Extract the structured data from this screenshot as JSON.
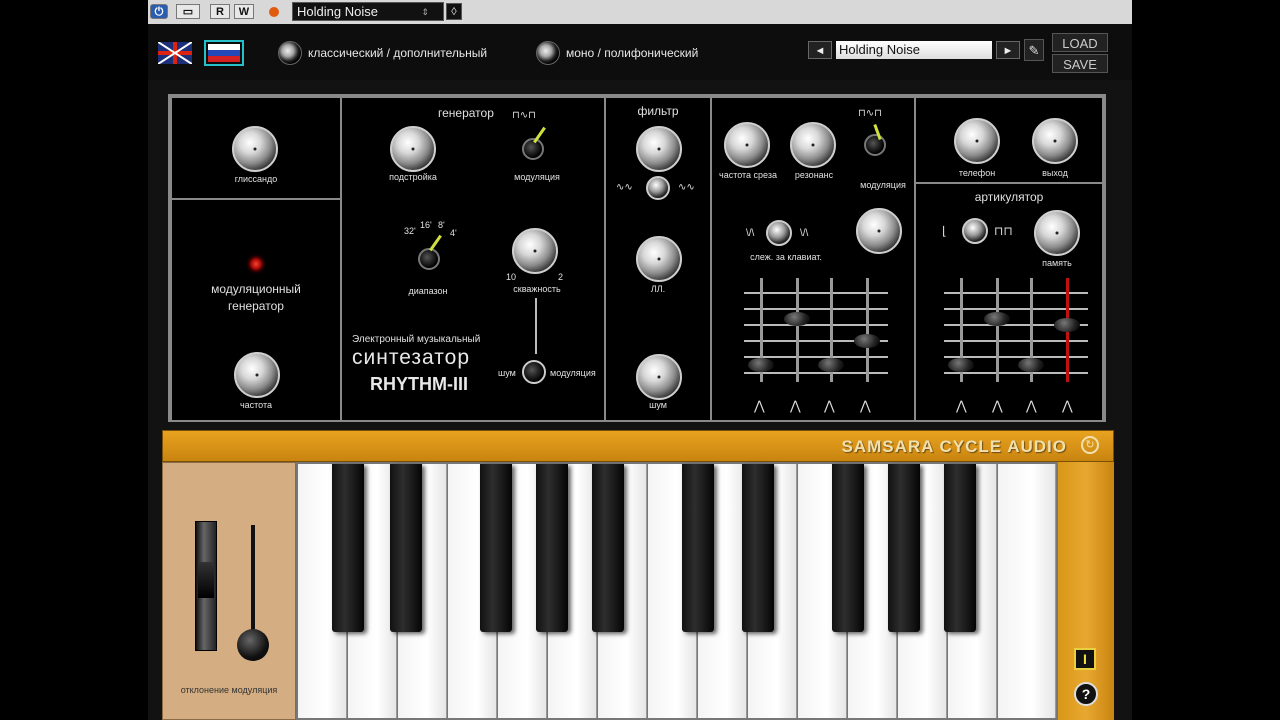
{
  "host": {
    "power_icon": "power-icon",
    "btn_window": "▭",
    "btn_r": "R",
    "btn_w": "W",
    "preset": "Holding Noise"
  },
  "top": {
    "mode1_label": "классический / дополнительный",
    "mode2_label": "моно / полифонический",
    "preset_name": "Holding Noise",
    "load": "LOAD",
    "save": "SAVE"
  },
  "panel": {
    "glide": "глиссандо",
    "mod_gen_line1": "модуляционный",
    "mod_gen_line2": "генератор",
    "frequency": "частота",
    "osc_title": "генератор",
    "tune": "подстройка",
    "modulation": "модуляция",
    "range": "диапазон",
    "range_marks": [
      "32'",
      "16'",
      "8'",
      "4'"
    ],
    "pulse_width": "скважность",
    "pw_min": "10",
    "pw_max": "2",
    "brand_small": "Электронный музыкальный",
    "brand_big": "синтезатор",
    "brand_model": "RHYTHM-III",
    "noise": "шум",
    "noise_mod": "модуляция",
    "filter_title": "фильтр",
    "filter_pulse": "ЛЛ.",
    "filter_noise": "шум",
    "cutoff": "частота среза",
    "resonance": "резонанс",
    "vcf_mod": "модуляция",
    "kbd_track": "слеж. за клавиат.",
    "kbd_left": "\\/\\",
    "kbd_right": "\\/\\",
    "phone": "телефон",
    "output": "выход",
    "articulator": "артикулятор",
    "memory": "память"
  },
  "keyboard": {
    "brand": "SAMSARA CYCLE AUDIO",
    "wheel_label": "отклонение модуляция",
    "info_icon": "I",
    "help_icon": "?"
  },
  "colors": {
    "orange": "#e0a020",
    "panel_border": "#8a8a8a",
    "led_red": "#cc1111"
  }
}
